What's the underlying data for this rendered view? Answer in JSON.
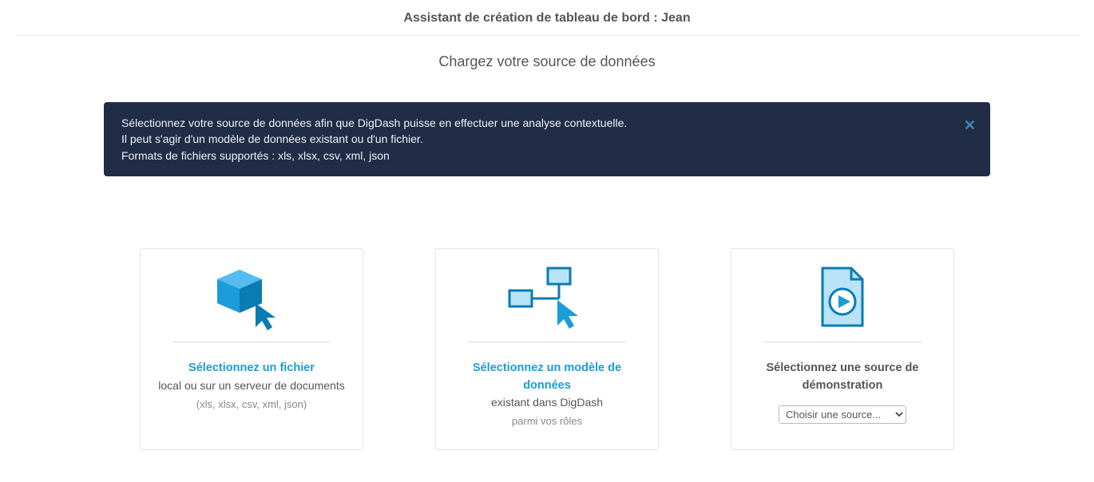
{
  "header": {
    "title": "Assistant de création de tableau de bord : Jean"
  },
  "subtitle": "Chargez votre source de données",
  "info": {
    "line1": "Sélectionnez votre source de données afin que DigDash puisse en effectuer une analyse contextuelle.",
    "line2": "Il peut s'agir d'un modèle de données existant ou d'un fichier.",
    "line3": "Formats de fichiers supportés : xls, xlsx, csv, xml, json"
  },
  "cards": {
    "file": {
      "accent": "Sélectionnez un fichier",
      "sub": "local ou sur un serveur de documents",
      "note": "(xls, xlsx, csv, xml, json)"
    },
    "model": {
      "accent": "Sélectionnez un modèle de données",
      "sub": "existant dans DigDash",
      "note": "parmi vos rôles"
    },
    "demo": {
      "title": "Sélectionnez une source de démonstration",
      "select_placeholder": "Choisir une source..."
    }
  }
}
